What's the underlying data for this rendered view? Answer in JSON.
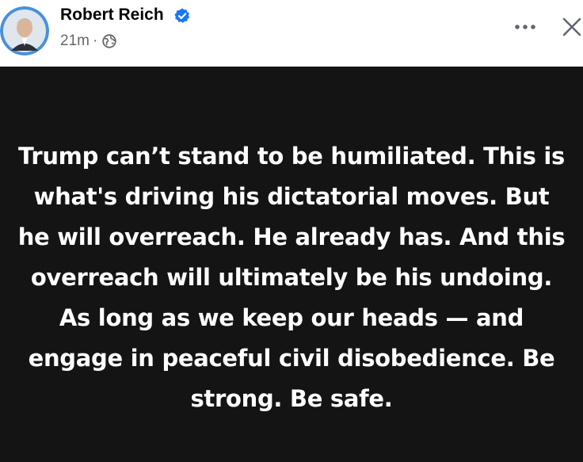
{
  "post": {
    "author": "Robert Reich",
    "verified": true,
    "timestamp": "21m",
    "separator": "·",
    "audience_icon": "globe-icon",
    "text": "Trump can’t stand to be humiliated. This is what's driving his dictatorial moves. But he will overreach. He already has. And this overreach will ultimately be his undoing. As long as we keep our heads — and engage in peaceful civil disobedience. Be strong. Be safe.",
    "background_color": "#141414",
    "text_color": "#ffffff"
  },
  "header": {
    "more_icon": "more-options-icon",
    "close_icon": "close-icon",
    "verified_color": "#1877f2"
  }
}
